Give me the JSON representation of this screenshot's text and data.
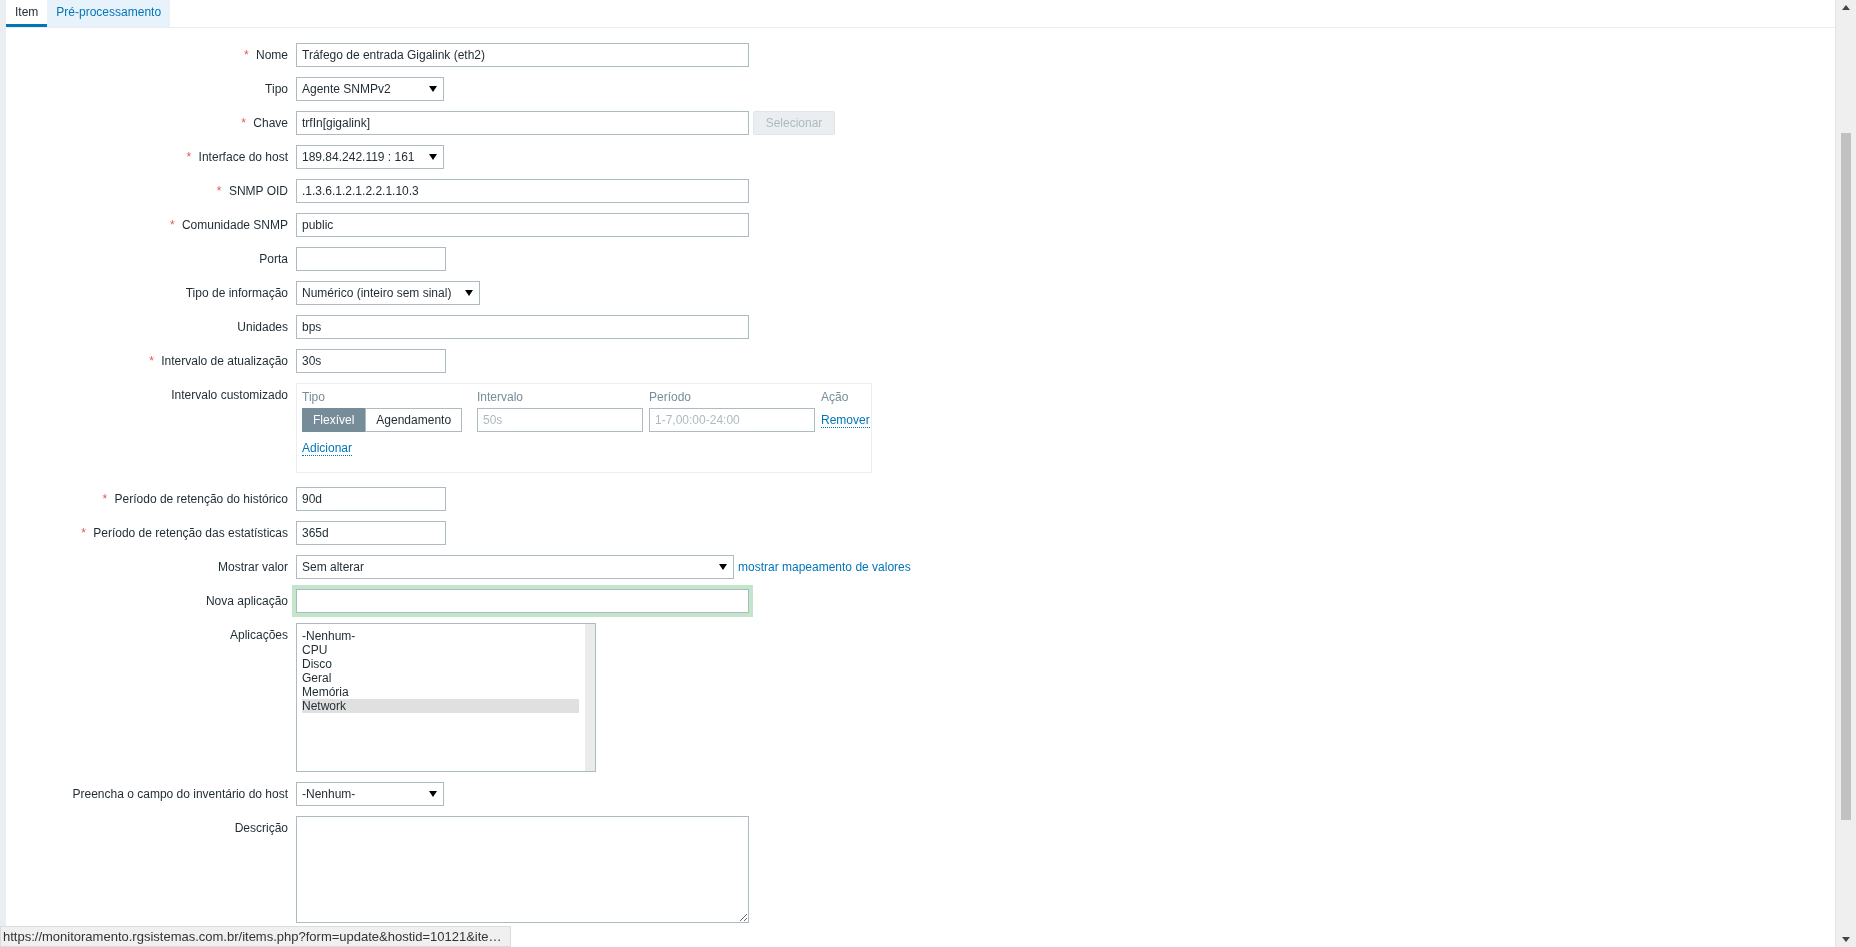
{
  "tabs": [
    {
      "label": "Item",
      "selected": true
    },
    {
      "label": "Pré-processamento",
      "selected": false
    }
  ],
  "fields": [
    {
      "kind": "text",
      "label": "Nome",
      "required_mark": "*",
      "focused": false,
      "value": "Tráfego de entrada Gigalink (eth2)"
    },
    {
      "kind": "select",
      "label": "Tipo",
      "value": "Agente SNMPv2"
    },
    {
      "kind": "text",
      "label": "Chave",
      "required_mark": "*",
      "focused": false,
      "value": "trfIn[gigalink]",
      "button": {
        "label": "Selecionar",
        "disabled": true
      }
    },
    {
      "kind": "select",
      "label": "Interface do host",
      "required_mark": "*",
      "value": "189.84.242.119 : 161"
    },
    {
      "kind": "text",
      "label": "SNMP OID",
      "required_mark": "*",
      "focused": false,
      "value": ".1.3.6.1.2.1.2.2.1.10.3"
    },
    {
      "kind": "text",
      "label": "Comunidade SNMP",
      "required_mark": "*",
      "focused": false,
      "value": "public"
    },
    {
      "kind": "short-text",
      "label": "Porta",
      "focused": false
    },
    {
      "kind": "select",
      "label": "Tipo de informação",
      "value": "Numérico (inteiro sem sinal)"
    },
    {
      "kind": "text",
      "label": "Unidades",
      "focused": false,
      "value": "bps"
    },
    {
      "kind": "short-text",
      "label": "Intervalo de atualização",
      "required_mark": "*",
      "focused": false,
      "value": "30s"
    },
    {
      "kind": "intervals",
      "label": "Intervalo customizado",
      "columns": [
        "Tipo",
        "Intervalo",
        "Período",
        "Ação"
      ],
      "rows": [
        {
          "modes": [
            {
              "label": "Flexível",
              "selected": true
            },
            {
              "label": "Agendamento",
              "selected": false
            }
          ],
          "interval_placeholder": "50s",
          "period_placeholder": "1-7,00:00-24:00",
          "action": "Remover"
        }
      ],
      "add": "Adicionar"
    },
    {
      "kind": "short-text",
      "label": "Período de retenção do histórico",
      "required_mark": "*",
      "focused": false,
      "value": "90d"
    },
    {
      "kind": "short-text",
      "label": "Período de retenção das estatísticas",
      "required_mark": "*",
      "focused": false,
      "value": "365d"
    },
    {
      "kind": "wide-select",
      "label": "Mostrar valor",
      "value": "Sem alterar",
      "link": "mostrar mapeamento de valores"
    },
    {
      "kind": "text",
      "label": "Nova aplicação",
      "focused": true
    },
    {
      "kind": "listbox",
      "label": "Aplicações",
      "options": [
        {
          "label": "-Nenhum-",
          "selected": false
        },
        {
          "label": "CPU",
          "selected": false
        },
        {
          "label": "Disco",
          "selected": false
        },
        {
          "label": "Geral",
          "selected": false
        },
        {
          "label": "Memória",
          "selected": false
        },
        {
          "label": "Network",
          "selected": true
        }
      ]
    },
    {
      "kind": "select",
      "label": "Preencha o campo do inventário do host",
      "value": "-Nenhum-"
    },
    {
      "kind": "textarea",
      "label": "Descrição"
    }
  ],
  "status_bar": {
    "url": "https://monitoramento.rgsistemas.com.br/items.php?form=update&hostid=10121&ite…"
  }
}
